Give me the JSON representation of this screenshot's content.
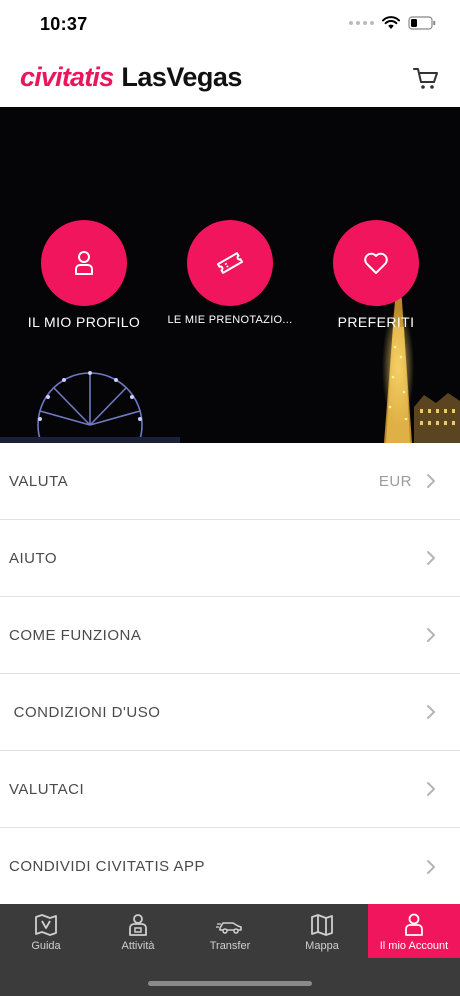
{
  "status_bar": {
    "time": "10:37"
  },
  "header": {
    "brand": "civitatis",
    "city": "LasVegas"
  },
  "hero": {
    "items": [
      {
        "label": "IL MIO PROFILO",
        "icon": "user-icon"
      },
      {
        "label": "LE MIE PRENOTAZIO...",
        "icon": "ticket-icon"
      },
      {
        "label": "PREFERITI",
        "icon": "heart-icon"
      }
    ]
  },
  "menu": {
    "items": [
      {
        "label": "VALUTA",
        "value": "EUR"
      },
      {
        "label": "AIUTO"
      },
      {
        "label": "COME FUNZIONA"
      },
      {
        "label": " CONDIZIONI D'USO"
      },
      {
        "label": "VALUTACI"
      },
      {
        "label": "CONDIVIDI CIVITATIS APP"
      }
    ]
  },
  "tabbar": {
    "items": [
      {
        "label": "Guida",
        "icon": "map-book-icon"
      },
      {
        "label": "Attività",
        "icon": "guide-person-icon"
      },
      {
        "label": "Transfer",
        "icon": "car-icon"
      },
      {
        "label": "Mappa",
        "icon": "folded-map-icon"
      },
      {
        "label": "Il mio Account",
        "icon": "user-icon"
      }
    ],
    "active_index": 4
  },
  "colors": {
    "accent": "#f0155c",
    "brand": "#e8175d",
    "tabbar_bg": "#3b3b3b"
  }
}
